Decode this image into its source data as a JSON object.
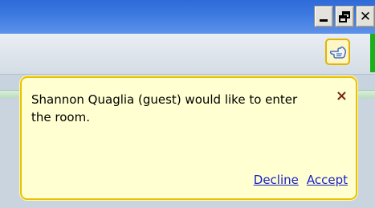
{
  "window": {
    "minimize_label": "_",
    "close_label": "✕"
  },
  "toolbar": {
    "icon": "hand-raise-icon"
  },
  "notification": {
    "message": "Shannon Quaglia (guest) would like to enter the room.",
    "close_label": "×",
    "decline_label": "Decline",
    "accept_label": "Accept"
  },
  "colors": {
    "titlebar": "#3a78e0",
    "toast_bg": "#ffffd1",
    "toast_border": "#e8c200",
    "link": "#1a22c8"
  }
}
